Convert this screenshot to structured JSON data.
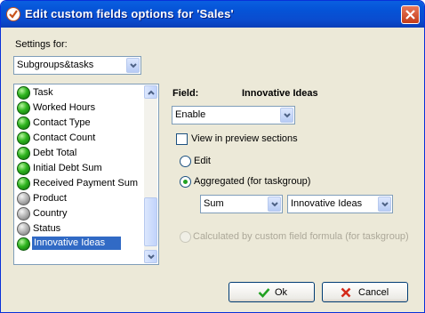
{
  "window": {
    "title": "Edit custom fields options for  'Sales'",
    "icon": "checkmark-app-icon",
    "close_icon": "close-icon"
  },
  "settings": {
    "label": "Settings for:",
    "selected": "Subgroups&tasks"
  },
  "fields_list": {
    "items": [
      {
        "label": "Task",
        "status": "green"
      },
      {
        "label": "Worked Hours",
        "status": "green"
      },
      {
        "label": "Contact Type",
        "status": "green"
      },
      {
        "label": "Contact Count",
        "status": "green"
      },
      {
        "label": "Debt Total",
        "status": "green"
      },
      {
        "label": "Initial Debt Sum",
        "status": "green"
      },
      {
        "label": "Received Payment Sum",
        "status": "green"
      },
      {
        "label": "Product",
        "status": "grey"
      },
      {
        "label": "Country",
        "status": "grey"
      },
      {
        "label": "Status",
        "status": "grey"
      },
      {
        "label": "Innovative Ideas",
        "status": "green",
        "selected": true
      }
    ]
  },
  "field_panel": {
    "field_label": "Field:",
    "field_name": "Innovative Ideas",
    "enable_value": "Enable",
    "view_preview_label": "View in preview sections",
    "view_preview_checked": false,
    "edit_label": "Edit",
    "aggregated_label": "Aggregated (for taskgroup)",
    "aggregated_selected": true,
    "agg_function": "Sum",
    "agg_field": "Innovative Ideas",
    "calculated_label": "Calculated by custom field formula (for taskgroup)"
  },
  "buttons": {
    "ok": "Ok",
    "cancel": "Cancel"
  },
  "colors": {
    "title_bar": "#0553d7",
    "dialog_bg": "#ece9d8",
    "selection": "#316ac5",
    "ok_check": "#21a121",
    "cancel_x": "#d42a1a"
  }
}
